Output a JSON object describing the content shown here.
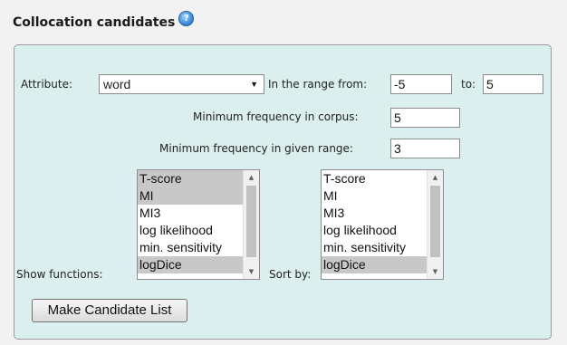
{
  "section": {
    "title": "Collocation candidates",
    "help_glyph": "?"
  },
  "form": {
    "attribute_label": "Attribute:",
    "attribute_value": "word",
    "range_label": "In the range from:",
    "range_from": "-5",
    "range_to_label": "to:",
    "range_to": "5",
    "min_freq_corpus_label": "Minimum frequency in corpus:",
    "min_freq_corpus": "5",
    "min_freq_range_label": "Minimum frequency in given range:",
    "min_freq_range": "3",
    "show_functions_label": "Show functions:",
    "sort_by_label": "Sort by:",
    "show_functions_options": [
      "T-score",
      "MI",
      "MI3",
      "log likelihood",
      "min. sensitivity",
      "logDice"
    ],
    "show_functions_selected": [
      "T-score",
      "MI",
      "logDice"
    ],
    "sort_by_options": [
      "T-score",
      "MI",
      "MI3",
      "log likelihood",
      "min. sensitivity",
      "logDice"
    ],
    "sort_by_selected": [
      "logDice"
    ],
    "submit_label": "Make Candidate List"
  },
  "colors": {
    "panel_background": "#dcefef",
    "selected_option": "#c8c8c8"
  }
}
